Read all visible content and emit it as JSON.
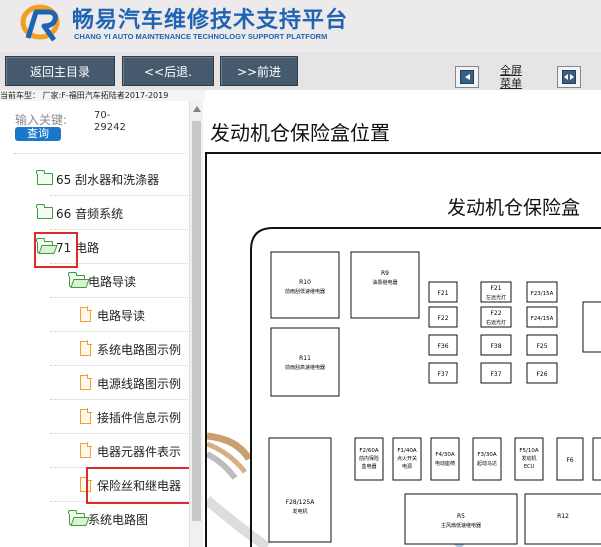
{
  "header": {
    "title": "畅易汽车维修技术支持平台",
    "subtitle": "CHANG YI AUTO MAINTENANCE TECHNOLOGY SUPPORT PLATFORM",
    "brand_color": "#1f64b4",
    "logo_icon": "r-swoosh-logo-icon"
  },
  "toolbar": {
    "home_label": "返回主目录",
    "back_label": "<<后退.",
    "forward_label": ">>前进",
    "collapse_icon": "collapse-left-icon",
    "fullscreen_label_line1": "全屏",
    "fullscreen_label_line2": "菜单",
    "expand_icon": "expand-both-icon"
  },
  "vehicle": {
    "text": "当前车型： 厂家:F-福田汽车拓陆者2017-2019"
  },
  "search": {
    "label": "输入关键:",
    "value": "70-\n29242",
    "button_label": "查询"
  },
  "tree": {
    "items": [
      {
        "label": "65 刮水器和洗涤器",
        "icon": "folder-icon"
      },
      {
        "label": "66 音频系统",
        "icon": "folder-icon"
      },
      {
        "label": "71 电路",
        "icon": "folder-open-icon",
        "highlighted": true
      },
      {
        "label": "电路导读",
        "icon": "folder-open-icon"
      },
      {
        "label": "电路导读",
        "icon": "document-icon"
      },
      {
        "label": "系统电路图示例",
        "icon": "document-icon"
      },
      {
        "label": "电源线路图示例",
        "icon": "document-icon"
      },
      {
        "label": "接插件信息示例",
        "icon": "document-icon"
      },
      {
        "label": "电器元器件表示",
        "icon": "document-icon"
      },
      {
        "label": "保险丝和继电器",
        "icon": "document-icon",
        "highlighted": true
      },
      {
        "label": "系统电路图",
        "icon": "folder-open-icon"
      }
    ]
  },
  "main": {
    "title": "发动机仓保险盒位置",
    "diagram_title": "发动机仓保险盒",
    "fuse_labels": {
      "r10_name": "R10",
      "r10_desc": "前雨刮低速继电器",
      "r9_name": "R9",
      "r9_desc": "油泵继电器",
      "r11_name": "R11",
      "r11_desc": "前雨刮高速继电器",
      "f21": "F21",
      "f21_desc": "左远光灯",
      "f22": "F22",
      "f22_desc": "右远光灯",
      "f23": "F23/15A",
      "f24": "F24/15A",
      "f41": "F21",
      "f42": "F22",
      "f36": "F36",
      "f38": "F38",
      "f25": "F25",
      "f37": "F37",
      "f37b": "F37",
      "f26": "F26",
      "f28": "F28/125A",
      "f28_desc": "发电机",
      "f2": "F2/60A",
      "f2_desc1": "前内保险",
      "f2_desc2": "盒电器",
      "f1": "F1/40A",
      "f1_desc1": "点火开关",
      "f1_desc2": "电源",
      "f4": "F4/30A",
      "f4_desc": "电动座椅",
      "f3": "F3/30A",
      "f3_desc": "起动马达",
      "f5": "F5/10A",
      "f5_desc1": "发动机",
      "f5_desc2": "ECU",
      "f6": "F6",
      "r5_name": "R5",
      "r5_desc": "主风扇低速继电器",
      "r12_name": "R12"
    }
  },
  "colors": {
    "nav_button_bg": "#465a6e",
    "highlight_border": "#e02a2a",
    "folder_green": "#3a9d3a",
    "doc_orange": "#f0a035",
    "search_button": "#1a77c9"
  }
}
